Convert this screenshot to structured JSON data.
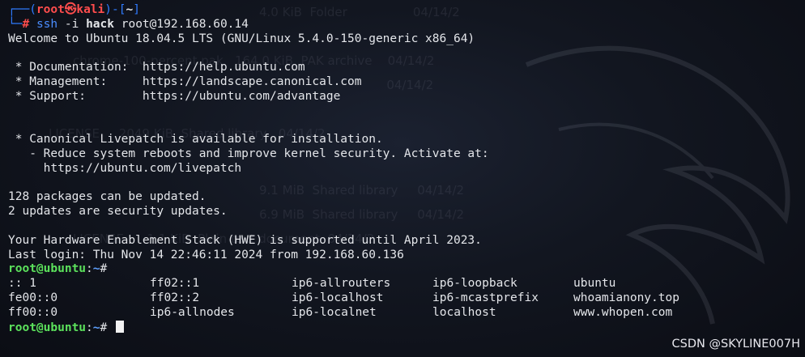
{
  "prompt1": {
    "corner_top": "┌──(",
    "user_host": "root㉿kali",
    "mid": ")-[",
    "cwd": "~",
    "end": "]",
    "corner_bottom": "└─",
    "hash": "#",
    "cmd_ssh": "ssh",
    "cmd_flag": "-i",
    "cmd_key": "hack",
    "cmd_target": "root@192.168.60.14"
  },
  "output": {
    "welcome": "Welcome to Ubuntu 18.04.5 LTS (GNU/Linux 5.4.0-150-generic x86_64)",
    "doc": " * Documentation:  https://help.ubuntu.com",
    "mgmt": " * Management:     https://landscape.canonical.com",
    "support": " * Support:        https://ubuntu.com/advantage",
    "livepatch1": " * Canonical Livepatch is available for installation.",
    "livepatch2": "   - Reduce system reboots and improve kernel security. Activate at:",
    "livepatch3": "     https://ubuntu.com/livepatch",
    "updates1": "128 packages can be updated.",
    "updates2": "2 updates are security updates.",
    "hwe": "Your Hardware Enablement Stack (HWE) is supported until April 2023.",
    "lastlogin": "Last login: Thu Nov 14 22:46:11 2024 from 192.168.60.136"
  },
  "prompt2": {
    "user_host": "root@ubuntu",
    "sep": ":",
    "cwd": "~",
    "hash": "#",
    "cmd": ""
  },
  "hosts_listing": [
    [
      ":: 1",
      "ff02::1",
      "ip6-allrouters",
      "ip6-loopback",
      "ubuntu"
    ],
    [
      "fe00::0",
      "ff02::2",
      "ip6-localhost",
      "ip6-mcastprefix",
      "whoamianony.top"
    ],
    [
      "ff00::0",
      "ip6-allnodes",
      "ip6-localnet",
      "localhost",
      "www.whopen.com"
    ]
  ],
  "prompt3": {
    "user_host": "root@ubuntu",
    "sep": ":",
    "cwd": "~",
    "hash": "#"
  },
  "watermark": "CSDN @SKYLINE007H",
  "colors": {
    "background": "#0d1019",
    "root_prompt": "#ff4d4d",
    "kali_frame": "#2f7bff",
    "ubuntu_user": "#5ce25c",
    "ubuntu_path": "#5ea0ff",
    "text": "#e4e6ea"
  }
}
